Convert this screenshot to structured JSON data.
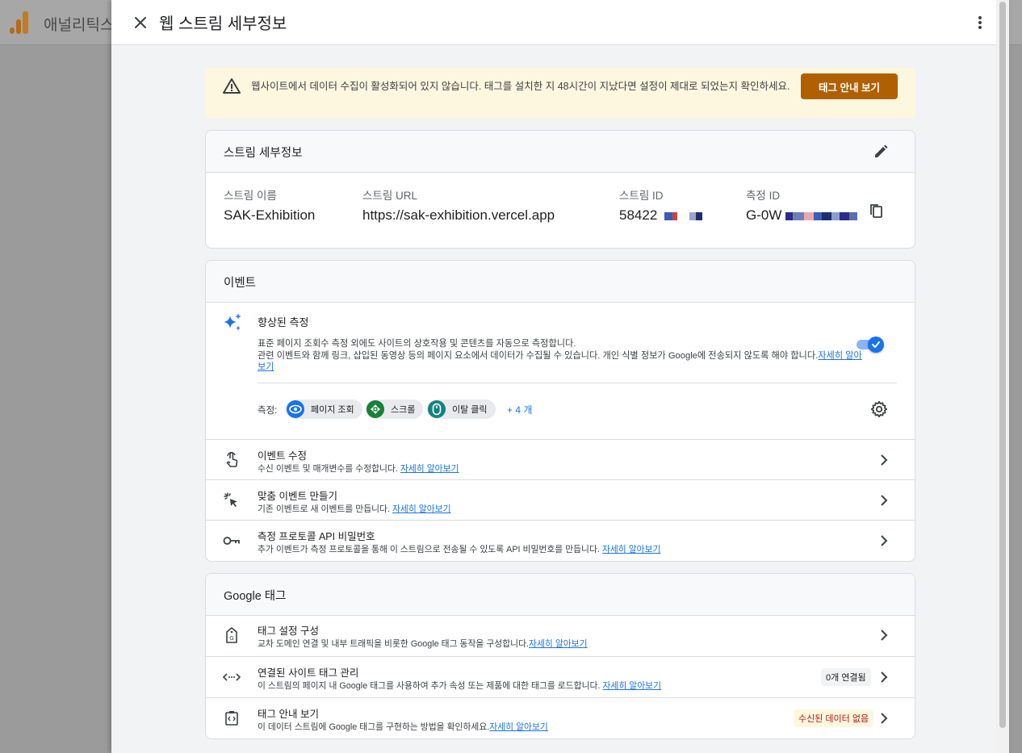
{
  "background": {
    "app_title": "애널리틱스"
  },
  "header": {
    "title": "웹 스트림 세부정보"
  },
  "warning": {
    "text": "웹사이트에서 데이터 수집이 활성화되어 있지 않습니다. 태그를 설치한 지 48시간이 지났다면 설정이 제대로 되었는지 확인하세요.",
    "button_label": "태그 안내 보기"
  },
  "stream_details": {
    "title": "스트림 세부정보",
    "name_label": "스트림 이름",
    "name_value": "SAK-Exhibition",
    "url_label": "스트림 URL",
    "url_value": "https://sak-exhibition.vercel.app",
    "id_label": "스트림 ID",
    "id_value": "58422",
    "measurement_label": "측정 ID",
    "measurement_value": "G-0W"
  },
  "events": {
    "title": "이벤트",
    "enhanced": {
      "title": "향상된 측정",
      "desc_line1": "표준 페이지 조회수 측정 외에도 사이트의 상호작용 및 콘텐츠를 자동으로 측정합니다.",
      "desc_line2": "관련 이벤트와 함께 링크, 삽입된 동영상 등의 페이지 요소에서 데이터가 수집될 수 있습니다. 개인 식별 정보가 Google에 전송되지 않도록 해야 합니다.",
      "learn_more": "자세히 알아보기",
      "enabled": true,
      "measure_label": "측정:",
      "chips": [
        {
          "label": "페이지 조회",
          "icon": "eye-icon",
          "color": "#1a73e8"
        },
        {
          "label": "스크롤",
          "icon": "scroll-icon",
          "color": "#188038"
        },
        {
          "label": "이탈 클릭",
          "icon": "mouse-icon",
          "color": "#12837f"
        }
      ],
      "more": "+ 4 개"
    },
    "rows": [
      {
        "title": "이벤트 수정",
        "sub": "수신 이벤트 및 매개변수를 수정합니다.",
        "link": "자세히 알아보기"
      },
      {
        "title": "맞춤 이벤트 만들기",
        "sub": "기존 이벤트로 새 이벤트를 만듭니다.",
        "link": "자세히 알아보기"
      },
      {
        "title": "측정 프로토콜 API 비밀번호",
        "sub": "추가 이벤트가 측정 프로토콜을 통해 이 스트림으로 전송될 수 있도록 API 비밀번호를 만듭니다.",
        "link": "자세히 알아보기"
      }
    ]
  },
  "google_tag": {
    "title": "Google 태그",
    "rows": [
      {
        "title": "태그 설정 구성",
        "sub": "교차 도메인 연결 및 내부 트래픽을 비롯한 Google 태그 동작을 구성합니다.",
        "link": "자세히 알아보기"
      },
      {
        "title": "연결된 사이트 태그 관리",
        "sub": "이 스트림의 페이지 내 Google 태그를 사용하여 추가 속성 또는 제품에 대한 태그를 로드합니다.",
        "link": "자세히 알아보기",
        "badge": "0개 연결됨"
      },
      {
        "title": "태그 안내 보기",
        "sub": "이 데이터 스트림에 Google 태그를 구현하는 방법을 확인하세요.",
        "link": "자세히 알아보기",
        "badge": "수신된 데이터 없음"
      }
    ]
  },
  "colors": {
    "accent": "#1a73e8",
    "warning_bg": "#fef7e0",
    "warning_button": "#b06000",
    "badge_warning_bg": "#fef7e0",
    "badge_warning_text": "#b31412"
  }
}
